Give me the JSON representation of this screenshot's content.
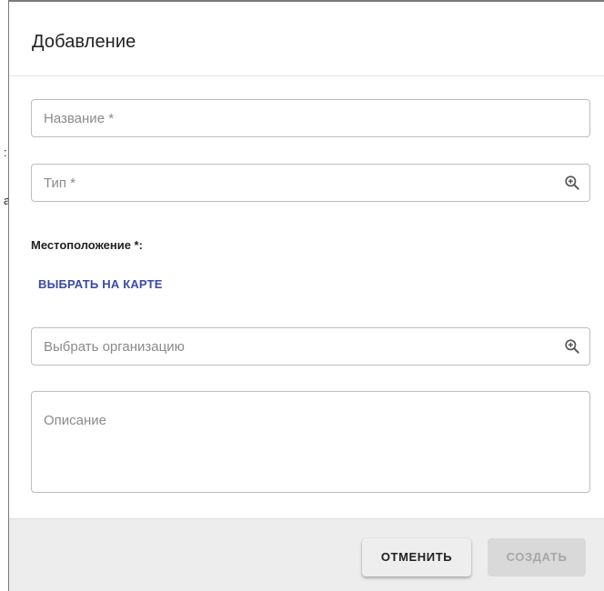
{
  "dialog": {
    "title": "Добавление"
  },
  "form": {
    "name_field": {
      "placeholder": "Название *"
    },
    "type_field": {
      "placeholder": "Тип *",
      "icon": "zoom-in-icon"
    },
    "location_label": "Местоположение *:",
    "map_link": "ВЫБРАТЬ НА КАРТЕ",
    "organization_field": {
      "placeholder": "Выбрать организацию",
      "icon": "zoom-in-icon"
    },
    "description_field": {
      "placeholder": "Описание"
    }
  },
  "footer": {
    "cancel_label": "ОТМЕНИТЬ",
    "create_label": "СОЗДАТЬ"
  },
  "colors": {
    "link": "#3949ab",
    "footer_bg": "#ededed",
    "border": "#bdbdbd"
  }
}
